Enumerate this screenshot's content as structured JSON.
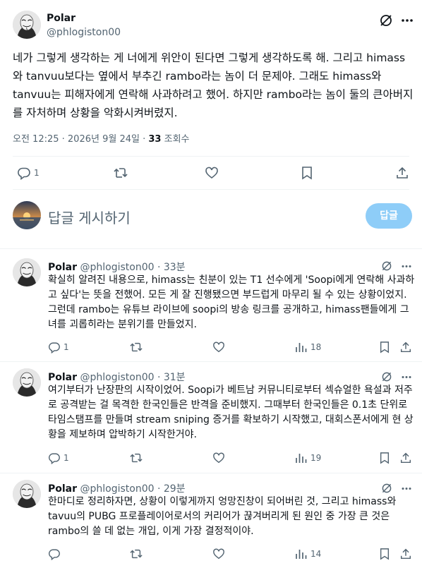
{
  "tweet": {
    "author_name": "Polar",
    "author_handle": "@phlogiston00",
    "text": "네가 그렇게 생각하는 게 너에게 위안이 된다면 그렇게 생각하도록 해. 그리고 himass와 tanvuu보다는 옆에서 부추긴 rambo라는 놈이 더 문제야. 그래도 himass와 tanvuu는 피해자에게 연락해 사과하려고 했어. 하지만 rambo라는 놈이 둘의 큰아버지를 자처하며 상황을 악화시켜버렸지.",
    "timestamp": "오전 12:25 · 2026년 9월 24일",
    "views_sep": " · ",
    "views_count": "33",
    "views_label": "조회수",
    "reply_count": "1"
  },
  "compose": {
    "placeholder": "답글 게시하기",
    "button_label": "답글"
  },
  "replies": [
    {
      "name": "Polar",
      "handle": "@phlogiston00 · 33분",
      "text": "확실히 알려진 내용으로, himass는 친분이 있는 T1 선수에게 'Soopi에게 연락해 사과하고 싶다'는 뜻을 전했어. 모든 게 잘 진행됐으면 부드럽게 마무리 될 수 있는 상황이었지. 그런데 rambo는 유튜브 라이브에 soopi의 방송 링크를 공개하고, himass팬들에게 그녀를 괴롭히라는 분위기를 만들었지.",
      "reply_count": "1",
      "view_count": "18"
    },
    {
      "name": "Polar",
      "handle": "@phlogiston00 · 31분",
      "text": "여기부터가 난장판의 시작이었어. Soopi가 베트남 커뮤니티로부터 섹슈얼한 욕설과 저주로 공격받는 걸 목격한 한국인들은 반격을 준비했지. 그때부터 한국인들은 0.1초 단위로 타임스탬프를 만들며 stream sniping 증거를 확보하기 시작했고, 대회스폰서에게 현 상황을 제보하며 압박하기 시작한거야.",
      "reply_count": "1",
      "view_count": "19"
    },
    {
      "name": "Polar",
      "handle": "@phlogiston00 · 29분",
      "text": "한마디로 정리하자면, 상황이 이렇게까지 엉망진창이 되어버린 것, 그리고 himass와 tavuu의 PUBG 프로플레이어로서의 커리어가 끊겨버리게 된 원인 중 가장 큰 것은 rambo의 쓸 데 없는 개입, 이게 가장 결정적이야.",
      "reply_count": "",
      "view_count": "14"
    }
  ],
  "icons": {
    "grok": "no-slash-icon",
    "more": "more-horizontal-icon",
    "reply": "reply-bubble-icon",
    "repost": "repost-icon",
    "like": "heart-icon",
    "bookmark": "bookmark-icon",
    "share": "share-upload-icon",
    "views": "analytics-bars-icon"
  },
  "colors": {
    "text": "#0f1419",
    "secondary": "#536471",
    "accent_disabled": "#8ecdf8",
    "divider": "#eff3f4"
  }
}
